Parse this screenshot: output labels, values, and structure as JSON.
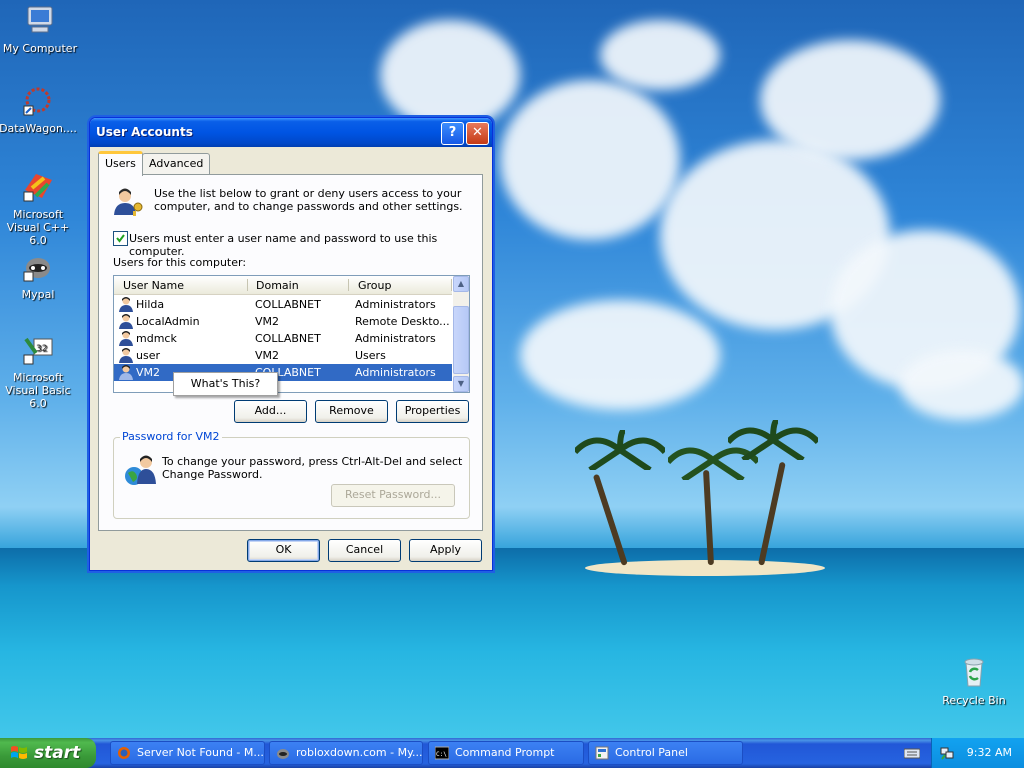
{
  "desktop": {
    "icons": [
      {
        "label": "My Computer",
        "icon": "my-computer-icon"
      },
      {
        "label": "DataWagon....",
        "icon": "datawagon-icon"
      },
      {
        "label": "Microsoft Visual C++ 6.0",
        "icon": "visual-cpp-icon"
      },
      {
        "label": "Mypal",
        "icon": "mypal-icon"
      },
      {
        "label": "Microsoft Visual Basic 6.0",
        "icon": "visual-basic-icon"
      },
      {
        "label": "Recycle Bin",
        "icon": "recycle-bin-icon"
      }
    ]
  },
  "window": {
    "title": "User Accounts",
    "help_button": "?",
    "close_button": "✕",
    "tabs": [
      {
        "label": "Users"
      },
      {
        "label": "Advanced"
      }
    ],
    "intro_text_1": "Use the list below to grant or deny users access to your",
    "intro_text_2": "computer, and to change passwords and other settings.",
    "checkbox_label": "Users must enter a user name and password to use this computer.",
    "checkbox_checked": true,
    "list_label": "Users for this computer:",
    "columns": [
      "User Name",
      "Domain",
      "Group"
    ],
    "rows": [
      {
        "name": "Hilda",
        "domain": "COLLABNET",
        "group": "Administrators"
      },
      {
        "name": "LocalAdmin",
        "domain": "VM2",
        "group": "Remote Deskto..."
      },
      {
        "name": "mdmck",
        "domain": "COLLABNET",
        "group": "Administrators"
      },
      {
        "name": "user",
        "domain": "VM2",
        "group": "Users"
      },
      {
        "name": "VM2",
        "domain": "COLLABNET",
        "group": "Administrators"
      }
    ],
    "selected_row": 4,
    "context_menu_item": "What's This?",
    "buttons": {
      "add": "Add...",
      "remove": "Remove",
      "properties": "Properties"
    },
    "password_group": {
      "legend": "Password for VM2",
      "text_1": "To change your password, press Ctrl-Alt-Del and select",
      "text_2": "Change Password.",
      "reset_button": "Reset Password..."
    },
    "footer": {
      "ok": "OK",
      "cancel": "Cancel",
      "apply": "Apply"
    }
  },
  "taskbar": {
    "start_label": "start",
    "tasks": [
      {
        "label": "Server Not Found - M...",
        "icon": "firefox-icon"
      },
      {
        "label": "robloxdown.com - My...",
        "icon": "browser-icon"
      },
      {
        "label": "Command Prompt",
        "icon": "command-prompt-icon"
      },
      {
        "label": "Control Panel",
        "icon": "control-panel-icon"
      }
    ],
    "clock": "9:32 AM"
  },
  "colors": {
    "titlebar": "#0054e3",
    "selection": "#316ac5",
    "start_button": "#3a9a39",
    "taskbar": "#2663e0"
  }
}
